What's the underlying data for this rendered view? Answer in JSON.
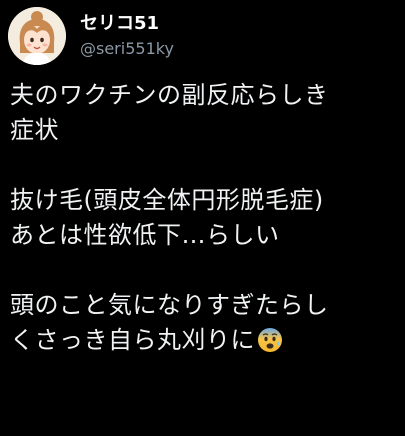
{
  "user": {
    "display_name": "セリコ51",
    "handle": "@seri551ky",
    "avatar_icon": "girl-avatar-icon"
  },
  "tweet": {
    "lines": [
      "夫のワクチンの副反応らしき",
      "症状",
      "",
      "抜け毛(頭皮全体円形脱毛症)",
      "あとは性欲低下…らしい",
      "",
      "頭のこと気になりすぎたらし",
      "くさっき自ら丸刈りに"
    ],
    "trailing_emoji": "fearful-face-emoji"
  },
  "colors": {
    "background": "#000000",
    "text": "#f0f2f3",
    "handle": "#8b98a5"
  }
}
